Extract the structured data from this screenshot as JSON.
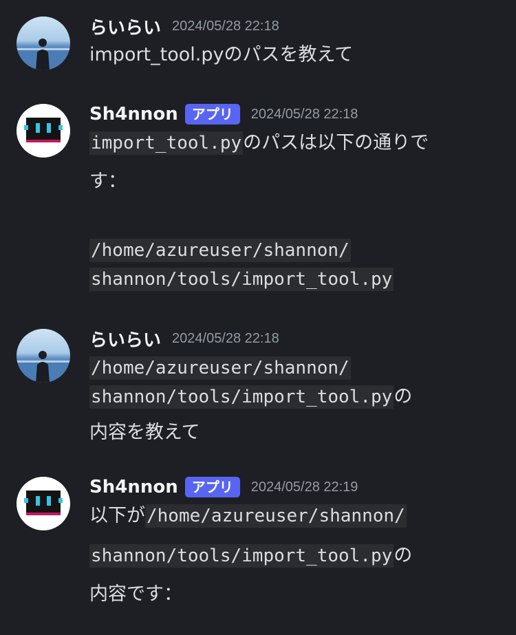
{
  "messages": [
    {
      "username": "らいらい",
      "timestamp": "2024/05/28 22:18",
      "text": "import_tool.pyのパスを教えて"
    },
    {
      "username": "Sh4nnon",
      "badge": "アプリ",
      "timestamp": "2024/05/28 22:18",
      "code1": "import_tool.py",
      "text1": "のパスは以下の通りで",
      "text2": "す：",
      "path1": "/home/azureuser/shannon/",
      "path2": "shannon/tools/import_tool.py"
    },
    {
      "username": "らいらい",
      "timestamp": "2024/05/28 22:18",
      "path1": "/home/azureuser/shannon/",
      "path2": "shannon/tools/import_tool.py",
      "text1": "の",
      "text2": "内容を教えて"
    },
    {
      "username": "Sh4nnon",
      "badge": "アプリ",
      "timestamp": "2024/05/28 22:19",
      "text0": "以下が",
      "path1": "/home/azureuser/shannon/",
      "path2": "shannon/tools/import_tool.py",
      "text1": "の",
      "text2": "内容です："
    }
  ],
  "icons": {
    "user_avatar": "photo-avatar-icon",
    "bot_avatar": "robot-avatar-icon"
  },
  "colors": {
    "background": "#1e1f24",
    "badge": "#5865f2",
    "code_bg": "#2b2d31",
    "timestamp": "#949ba4"
  }
}
